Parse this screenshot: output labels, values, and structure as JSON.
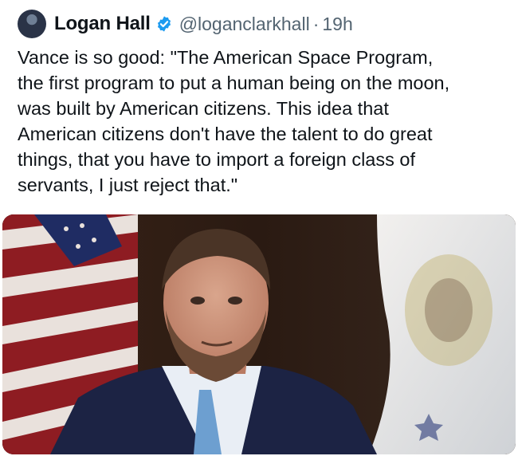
{
  "tweet": {
    "author_name": "Logan Hall",
    "handle": "@loganclarkhall",
    "separator": "·",
    "time": "19h",
    "text_lines": [
      "Vance is so good: \"The American Space Program,",
      "the first program to put a human being on the moon,",
      "was built by American citizens. This idea that",
      "American citizens don't have the talent to do great",
      "things, that you have to import a foreign class of",
      "servants, I just reject that.\""
    ]
  },
  "icons": {
    "avatar": "avatar",
    "verified": "verified-badge-icon"
  },
  "colors": {
    "verified_blue": "#1d9bf0",
    "secondary_text": "#536471",
    "primary_text": "#0f1419"
  }
}
